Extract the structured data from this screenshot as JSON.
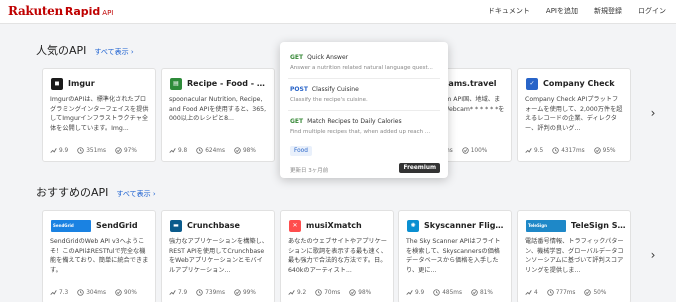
{
  "header": {
    "logo": {
      "brand": "Rakuten",
      "product": "Rapid",
      "suffix": "API"
    },
    "nav": [
      "ドキュメント",
      "APIを追加",
      "新規登録",
      "ログイン"
    ]
  },
  "popular": {
    "title": "人気のAPI",
    "see_all": "すべて表示 ›",
    "cards": [
      {
        "name": "Imgur",
        "logo_text": "◼",
        "logo_color": "#1b1b1b",
        "desc": "ImgurのAPIは、標準化されたプログラミングインターフェイスを提供してImgurインフラストラクチャ全体を公開しています。Img...",
        "score": "9.9",
        "latency": "351ms",
        "success": "97%"
      },
      {
        "name": "Recipe - Food - Nutrition",
        "logo_text": "▤",
        "logo_color": "#2e8b3a",
        "desc": "spoonacular Nutrition, Recipe, and Food APIを使用すると、365,000以上のレシピと8...",
        "score": "9.8",
        "latency": "624ms",
        "success": "98%"
      },
      {
        "name": "Webcams.travel",
        "logo_text": "◉",
        "logo_color": "#3c6fc8",
        "desc": "の風景Webcam API国、地域、またぐで近所のWebcam* * * * * *を",
        "score": "",
        "latency": "367ms",
        "success": "100%"
      },
      {
        "name": "Company Check",
        "logo_text": "✓",
        "logo_color": "#2864c8",
        "desc": "Company Check APIプラットフォームを使用して、2,000万件を超えるレコードの企業、ディレクター、評判の良いグ...",
        "score": "9.5",
        "latency": "4317ms",
        "success": "95%"
      }
    ]
  },
  "recommended": {
    "title": "おすすめのAPI",
    "see_all": "すべて表示 ›",
    "cards": [
      {
        "name": "SendGrid",
        "logo_text": "SendGrid",
        "logo_color": "#1a82e2",
        "desc": "SendGridのWeb API v3へようこそ！このAPIはRESTfulで完全な機能を備えており、簡単に統合できます。",
        "score": "7.3",
        "latency": "304ms",
        "success": "90%"
      },
      {
        "name": "Crunchbase",
        "logo_text": "▬",
        "logo_color": "#0a5b8c",
        "desc": "強力なアプリケーションを構築し、REST APIを使用してCrunchbaseをWebアプリケーションとモバイルアプリケーション...",
        "score": "7.9",
        "latency": "739ms",
        "success": "99%"
      },
      {
        "name": "musiXmatch",
        "logo_text": "✕",
        "logo_color": "#ff4d4d",
        "desc": "あなたのウェブサイトやアプリケーションに歌詞を表示する最も速く、最も強力で合法的な方法です。日。640kのアーティスト...",
        "score": "9.2",
        "latency": "70ms",
        "success": "98%"
      },
      {
        "name": "Skyscanner Flight Search",
        "logo_text": "✺",
        "logo_color": "#0a8fd1",
        "desc": "The Sky Scanner APIはフライトを検索して、Skyscannersの価格データベースから価格を入手したり、更に...",
        "score": "9.9",
        "latency": "485ms",
        "success": "81%"
      },
      {
        "name": "TeleSign Score",
        "logo_text": "TeleSign",
        "logo_color": "#1e88c8",
        "desc": "電話番号情報、トラフィックパターン、機械学習、グローバルデータコンソーシアムに基づいて評判スコアリングを提供しま...",
        "score": "4",
        "latency": "777ms",
        "success": "50%"
      }
    ]
  },
  "popover": {
    "endpoints": [
      {
        "method": "GET",
        "name": "Quick Answer",
        "desc": "Answer a nutrition related natural language quest..."
      },
      {
        "method": "POST",
        "name": "Classify Cuisine",
        "desc": "Classify the recipe's cuisine."
      },
      {
        "method": "GET",
        "name": "Match Recipes to Daily Calories",
        "desc": "Find multiple recipes that, when added up reach ..."
      }
    ],
    "tag": "Food",
    "updated": "更新日 3ヶ月前",
    "pricing": "Freemium"
  }
}
